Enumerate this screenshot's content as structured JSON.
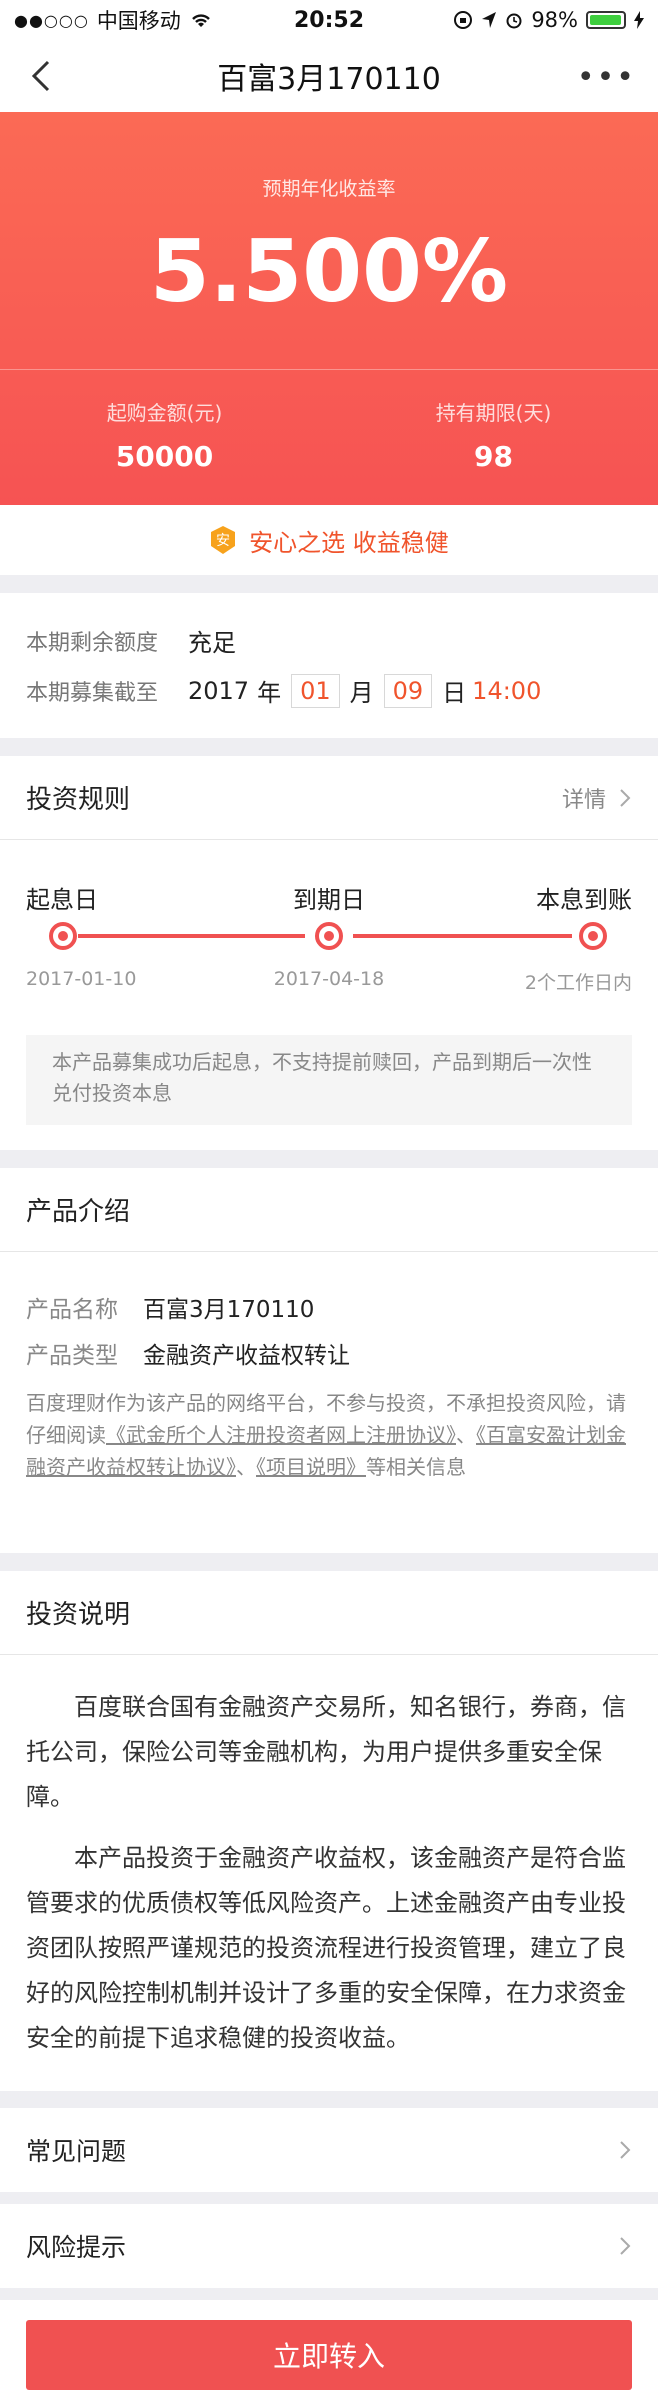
{
  "status_bar": {
    "carrier": "中国移动",
    "time": "20:52",
    "battery": "98%",
    "battery_level": 0.98
  },
  "nav": {
    "title": "百富3月170110"
  },
  "hero": {
    "rate_label": "预期年化收益率",
    "rate": "5.500%",
    "min_amount_label": "起购金额(元)",
    "min_amount": "50000",
    "term_label": "持有期限(天)",
    "term": "98"
  },
  "slogan": {
    "badge": "安",
    "text": "安心之选 收益稳健"
  },
  "period": {
    "remaining_label": "本期剩余额度",
    "remaining_value": "充足",
    "deadline_label": "本期募集截至",
    "year": "2017",
    "year_unit": "年",
    "month": "01",
    "month_unit": "月",
    "day": "09",
    "day_unit": "日",
    "time": "14:00"
  },
  "rules": {
    "title": "投资规则",
    "detail": "详情",
    "steps": [
      {
        "label": "起息日",
        "date": "2017-01-10"
      },
      {
        "label": "到期日",
        "date": "2017-04-18"
      },
      {
        "label": "本息到账",
        "date": "2个工作日内"
      }
    ],
    "note": "本产品募集成功后起息，不支持提前赎回，产品到期后一次性兑付投资本息"
  },
  "intro": {
    "title": "产品介绍",
    "name_label": "产品名称",
    "name_value": "百富3月170110",
    "type_label": "产品类型",
    "type_value": "金融资产收益权转让",
    "disclaimer_pre": "百度理财作为该产品的网络平台，不参与投资，不承担投资风险，请仔细阅读",
    "link1": "《武金所个人注册投资者网上注册协议》",
    "sep1": "、",
    "link2": "《百富安盈计划金融资产收益权转让协议》",
    "sep2": "、",
    "link3": "《项目说明》",
    "disclaimer_post": "等相关信息"
  },
  "invest": {
    "title": "投资说明",
    "para1": "百度联合国有金融资产交易所，知名银行，券商，信托公司，保险公司等金融机构，为用户提供多重安全保障。",
    "para2": "本产品投资于金融资产收益权，该金融资产是符合监管要求的优质债权等低风险资产。上述金融资产由专业投资团队按照严谨规范的投资流程进行投资管理，建立了良好的风险控制机制并设计了多重的安全保障，在力求资金安全的前提下追求稳健的投资收益。"
  },
  "faq": {
    "label": "常见问题"
  },
  "risk": {
    "label": "风险提示"
  },
  "cta": {
    "label": "立即转入"
  },
  "colors": {
    "accent": "#f65353",
    "highlight": "#f0542c"
  }
}
